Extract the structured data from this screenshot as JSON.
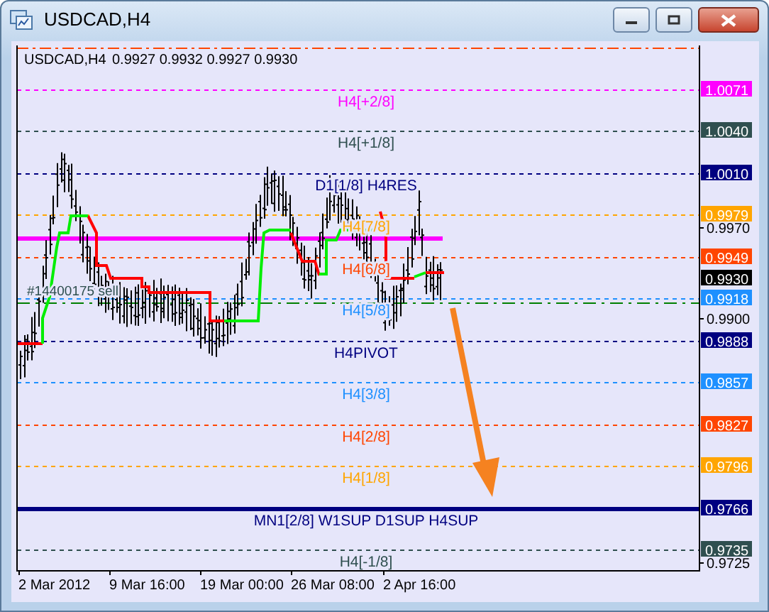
{
  "window": {
    "title": "USDCAD,H4"
  },
  "chart": {
    "symbol": "USDCAD,H4",
    "quote": "0.9927 0.9932 0.9927 0.9930",
    "order_label": "#14400175 sell",
    "levels": [
      {
        "label": "H4[+2/8]",
        "price": "1.0071",
        "color": "#ff00ff",
        "kind": "dashed"
      },
      {
        "label": "H4[+1/8]",
        "price": "1.0040",
        "color": "#2f4f4f",
        "kind": "dashed"
      },
      {
        "label": "D1[1/8] H4RES",
        "price": "1.0010",
        "color": "#000080",
        "kind": "dashed"
      },
      {
        "label": "H4[7/8]",
        "price": "0.9979",
        "color": "#ffa500",
        "kind": "dashed"
      },
      {
        "label": "H4[6/8]",
        "price": "0.9949",
        "color": "#ff4500",
        "kind": "dashed"
      },
      {
        "label": "H4[5/8]",
        "price": "0.9918",
        "color": "#1e90ff",
        "kind": "dashed"
      },
      {
        "label": "H4PIVOT",
        "price": "0.9888",
        "color": "#000080",
        "kind": "dashed"
      },
      {
        "label": "H4[3/8]",
        "price": "0.9857",
        "color": "#1e90ff",
        "kind": "dashed"
      },
      {
        "label": "H4[2/8]",
        "price": "0.9827",
        "color": "#ff4500",
        "kind": "dashed"
      },
      {
        "label": "H4[1/8]",
        "price": "0.9796",
        "color": "#ffa500",
        "kind": "dashed"
      },
      {
        "label": "MN1[2/8] W1SUP D1SUP H4SUP",
        "price": "0.9766",
        "color": "#000080",
        "kind": "solid"
      },
      {
        "label": "H4[-1/8]",
        "price": "0.9735",
        "color": "#2f4f4f",
        "kind": "dashed"
      }
    ],
    "current_price": "0.9930",
    "price_ticks": [
      "0.9970",
      "0.9900",
      "0.9725"
    ],
    "time_labels": [
      "2 Mar 2012",
      "9 Mar 16:00",
      "19 Mar 00:00",
      "26 Mar 08:00",
      "2 Apr 16:00"
    ]
  }
}
